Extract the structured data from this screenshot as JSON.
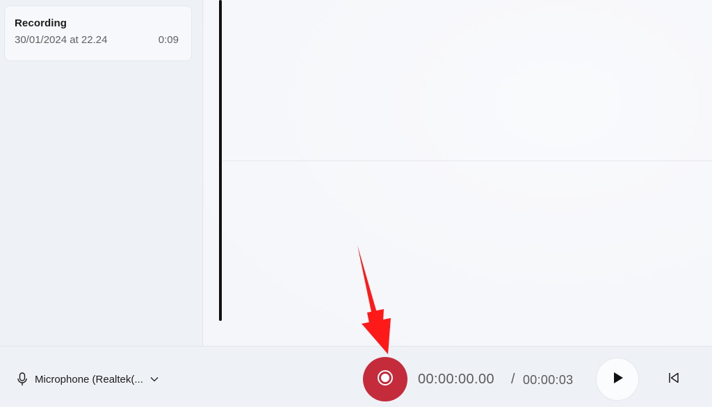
{
  "sidebar": {
    "recordings": [
      {
        "title": "Recording",
        "date": "30/01/2024 at 22.24",
        "duration": "0:09"
      }
    ]
  },
  "bottom_bar": {
    "microphone_label": "Microphone (Realtek(...",
    "current_time": "00:00:00.00",
    "separator": "/",
    "total_time": "00:00:03"
  },
  "icons": {
    "microphone": "microphone-icon",
    "chevron": "chevron-down-icon",
    "record": "record-icon",
    "play": "play-icon",
    "skip_back": "skip-to-start-icon",
    "annotation": "red-arrow-annotation"
  },
  "colors": {
    "record_button": "#c42b3b",
    "annotation_arrow": "#ff1a1a",
    "playhead": "#111111"
  }
}
